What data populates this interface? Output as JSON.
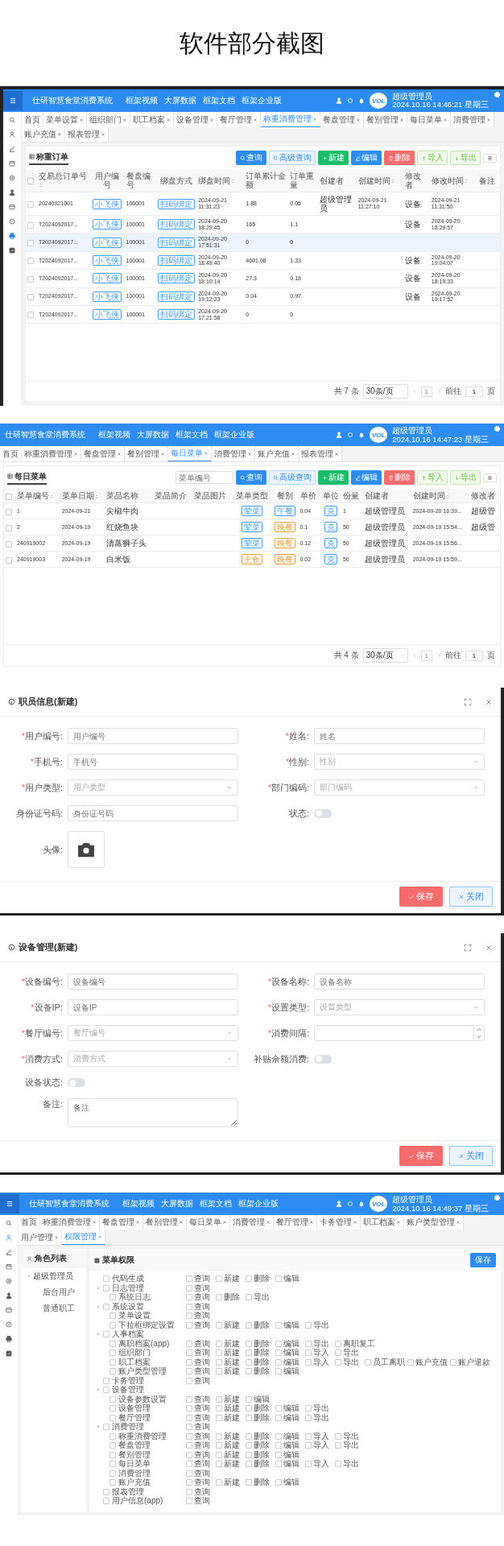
{
  "page_title": "软件部分截图",
  "order_screen": {
    "header": {
      "system_title": "仕研智慧食堂消费系统",
      "nav_links": [
        "框架视频",
        "大屏数据",
        "框架文档",
        "框架企业版"
      ],
      "logo_text": "VOL",
      "user_name": "超级管理员",
      "datetime": "2024.10.16 14:46:21 星期三"
    },
    "sidebar": [
      {
        "kind": "search",
        "selected": false
      },
      {
        "kind": "user",
        "selected": false
      },
      {
        "kind": "pen",
        "selected": false
      },
      {
        "kind": "calendar",
        "selected": false
      },
      {
        "kind": "gear",
        "selected": false
      },
      {
        "kind": "person",
        "selected": false
      },
      {
        "kind": "card",
        "selected": false
      },
      {
        "kind": "link",
        "selected": false
      },
      {
        "kind": "printer",
        "selected": true
      },
      {
        "kind": "checklist",
        "selected": false
      }
    ],
    "tabs": [
      {
        "label": "首页",
        "selected": false,
        "closable": false
      },
      {
        "label": "菜单设置",
        "selected": false,
        "closable": true
      },
      {
        "label": "组织部门",
        "selected": false,
        "closable": true
      },
      {
        "label": "职工档案",
        "selected": false,
        "closable": true
      },
      {
        "label": "设备管理",
        "selected": false,
        "closable": true
      },
      {
        "label": "餐厅管理",
        "selected": false,
        "closable": true
      },
      {
        "label": "称重消费管理",
        "selected": true,
        "closable": true
      },
      {
        "label": "餐盘管理",
        "selected": false,
        "closable": true
      },
      {
        "label": "餐别管理",
        "selected": false,
        "closable": true
      },
      {
        "label": "每日菜单",
        "selected": false,
        "closable": true
      },
      {
        "label": "消费管理",
        "selected": false,
        "closable": true
      },
      {
        "label": "账户充值",
        "selected": false,
        "closable": true
      },
      {
        "label": "报表管理",
        "selected": false,
        "closable": true
      }
    ],
    "panel_title": "称重订单",
    "toolbar": [
      {
        "label": "查询",
        "kind": "query"
      },
      {
        "label": "高级查询",
        "kind": "advanced"
      },
      {
        "label": "新建",
        "kind": "create"
      },
      {
        "label": "编辑",
        "kind": "edit"
      },
      {
        "label": "删除",
        "kind": "delete"
      },
      {
        "label": "导入",
        "kind": "import"
      },
      {
        "label": "导出",
        "kind": "export"
      }
    ],
    "table": {
      "header_checked": false,
      "columns": [
        {
          "title": "交易总订单号",
          "kind": "code",
          "sortable": true
        },
        {
          "title": "用户编号",
          "kind": "tag",
          "sortable": false
        },
        {
          "title": "餐盘编号",
          "kind": "code",
          "sortable": false
        },
        {
          "title": "绑盘方式",
          "kind": "tag",
          "sortable": false
        },
        {
          "title": "绑盘时间",
          "kind": "code",
          "sortable": true
        },
        {
          "title": "订单累计金额",
          "kind": "code",
          "sortable": false
        },
        {
          "title": "订单重量",
          "kind": "code",
          "sortable": false
        },
        {
          "title": "创建者",
          "kind": "text",
          "sortable": false
        },
        {
          "title": "创建时间",
          "kind": "code",
          "sortable": true
        },
        {
          "title": "修改者",
          "kind": "text",
          "sortable": false
        },
        {
          "title": "修改时间",
          "kind": "code",
          "sortable": true
        },
        {
          "title": "备注",
          "kind": "text",
          "sortable": false
        }
      ],
      "rows": [
        {
          "selected": false,
          "checked": false,
          "cells": [
            "20240921001",
            {
              "text": "小飞侠",
              "color": "#409eff"
            },
            "100001",
            {
              "text": "扫码绑定",
              "color": "#409eff"
            },
            "2024-09-21 11:31:23",
            "1.88",
            "0.05",
            "超级管理员",
            "2024-09-21 11:27:10",
            "设备",
            "2024-09-21 11:31:50",
            null
          ]
        },
        {
          "selected": false,
          "checked": false,
          "cells": [
            "T2024092017...",
            {
              "text": "小飞侠",
              "color": "#409eff"
            },
            "100001",
            {
              "text": "扫码绑定",
              "color": "#409eff"
            },
            "2024-09-20 18:29:45",
            "165",
            "1.1",
            null,
            null,
            "设备",
            "2024-09-20 18:29:57",
            null
          ]
        },
        {
          "selected": true,
          "checked": false,
          "cells": [
            "T2024092017...",
            {
              "text": "小飞侠",
              "color": "#409eff"
            },
            "100001",
            {
              "text": "扫码绑定",
              "color": "#409eff"
            },
            "2024-09-20 17:51:31",
            "0",
            "0",
            null,
            null,
            null,
            null,
            null
          ]
        },
        {
          "selected": false,
          "checked": false,
          "cells": [
            "T2024092017...",
            {
              "text": "小飞侠",
              "color": "#409eff"
            },
            "100001",
            {
              "text": "扫码绑定",
              "color": "#409eff"
            },
            "2024-09-20 18:49:40",
            "4601.08",
            "1.33",
            null,
            null,
            "设备",
            "2024-09-20 19:04:07",
            null
          ]
        },
        {
          "selected": false,
          "checked": false,
          "cells": [
            "T2024092017...",
            {
              "text": "小飞侠",
              "color": "#409eff"
            },
            "100001",
            {
              "text": "扫码绑定",
              "color": "#409eff"
            },
            "2024-09-20 18:10:14",
            "27.3",
            "0.18",
            null,
            null,
            "设备",
            "2024-09-20 18:19:33",
            null
          ]
        },
        {
          "selected": false,
          "checked": false,
          "cells": [
            "T2024092017...",
            {
              "text": "小飞侠",
              "color": "#409eff"
            },
            "100001",
            {
              "text": "扫码绑定",
              "color": "#409eff"
            },
            "2024-09-20 19:12:23",
            "0.04",
            "0.97",
            null,
            null,
            "设备",
            "2024-09-20 19:17:52",
            null
          ]
        },
        {
          "selected": false,
          "checked": false,
          "cells": [
            "T2024092017...",
            {
              "text": "小飞侠",
              "color": "#409eff"
            },
            "100001",
            {
              "text": "扫码绑定",
              "color": "#409eff"
            },
            "2024-09-20 17:21:58",
            "0",
            "0",
            null,
            null,
            null,
            null,
            null
          ]
        }
      ]
    },
    "pagination": {
      "total": "共 7 条",
      "page_size": "30条/页",
      "pages": [
        {
          "label": "1",
          "selected": true
        }
      ],
      "goto_label": "前往",
      "goto_value": "1",
      "page_suffix": "页"
    }
  },
  "menu_screen": {
    "header": {
      "system_title": "仕研智慧食堂消费系统",
      "nav_links": [
        "框架视频",
        "大屏数据",
        "框架文档",
        "框架企业版"
      ],
      "logo_text": "VOL",
      "user_name": "超级管理员",
      "datetime": "2024.10.16 14:47:23 星期三"
    },
    "tabs": [
      {
        "label": "首页",
        "selected": false,
        "closable": false
      },
      {
        "label": "称重消费管理",
        "selected": false,
        "closable": true
      },
      {
        "label": "餐盘管理",
        "selected": false,
        "closable": true
      },
      {
        "label": "餐别管理",
        "selected": false,
        "closable": true
      },
      {
        "label": "每日菜单",
        "selected": true,
        "closable": true
      },
      {
        "label": "消费管理",
        "selected": false,
        "closable": true
      },
      {
        "label": "账户充值",
        "selected": false,
        "closable": true
      },
      {
        "label": "报表管理",
        "selected": false,
        "closable": true
      }
    ],
    "panel_title": "每日菜单",
    "search": {
      "placeholder": "菜单编号"
    },
    "toolbar": [
      {
        "label": "查询",
        "kind": "query"
      },
      {
        "label": "高级查询",
        "kind": "advanced"
      },
      {
        "label": "新建",
        "kind": "create"
      },
      {
        "label": "编辑",
        "kind": "edit"
      },
      {
        "label": "删除",
        "kind": "delete"
      },
      {
        "label": "导入",
        "kind": "import"
      },
      {
        "label": "导出",
        "kind": "export"
      }
    ],
    "table": {
      "header_checked": false,
      "columns": [
        {
          "title": "菜单编号",
          "kind": "code",
          "sortable": true
        },
        {
          "title": "菜单日期",
          "kind": "code",
          "sortable": true
        },
        {
          "title": "菜品名称",
          "kind": "text",
          "sortable": false
        },
        {
          "title": "菜品简介",
          "kind": "text",
          "sortable": false
        },
        {
          "title": "菜品图片",
          "kind": "text",
          "sortable": false
        },
        {
          "title": "菜单类型",
          "kind": "tag",
          "sortable": false
        },
        {
          "title": "餐别",
          "kind": "tag",
          "sortable": false
        },
        {
          "title": "单价",
          "kind": "code",
          "sortable": false
        },
        {
          "title": "单位",
          "kind": "tag",
          "sortable": false
        },
        {
          "title": "份量",
          "kind": "code",
          "sortable": false
        },
        {
          "title": "创建者",
          "kind": "text",
          "sortable": false
        },
        {
          "title": "创建时间",
          "kind": "code",
          "sortable": true
        },
        {
          "title": "修改者",
          "kind": "text",
          "sortable": false
        }
      ],
      "rows": [
        {
          "selected": false,
          "checked": false,
          "cells": [
            "1",
            "2024-09-21",
            "尖椒牛肉",
            null,
            null,
            {
              "text": "荤菜",
              "color": "#409eff"
            },
            {
              "text": "午餐",
              "color": "#409eff"
            },
            "0.04",
            {
              "text": "克",
              "color": "#409eff"
            },
            "1",
            "超级管理员",
            "2024-09-20 16:39...",
            "超级管"
          ]
        },
        {
          "selected": false,
          "checked": false,
          "cells": [
            "2",
            "2024-09-19",
            "红烧鱼块",
            null,
            null,
            {
              "text": "荤菜",
              "color": "#409eff"
            },
            {
              "text": "晚餐",
              "color": "#e6a23c"
            },
            "0.1",
            {
              "text": "克",
              "color": "#409eff"
            },
            "50",
            "超级管理员",
            "2024-09-19 15:54...",
            "超级管"
          ]
        },
        {
          "selected": false,
          "checked": false,
          "cells": [
            "240919002",
            "2024-09-19",
            "清蒸狮子头",
            null,
            null,
            {
              "text": "荤菜",
              "color": "#409eff"
            },
            {
              "text": "晚餐",
              "color": "#e6a23c"
            },
            "0.12",
            {
              "text": "克",
              "color": "#409eff"
            },
            "50",
            "超级管理员",
            "2024-09-19 15:56...",
            null
          ]
        },
        {
          "selected": false,
          "checked": false,
          "cells": [
            "240919003",
            "2024-09-19",
            "白米饭",
            null,
            null,
            {
              "text": "主食",
              "color": "#e6a23c"
            },
            {
              "text": "晚餐",
              "color": "#e6a23c"
            },
            "0.02",
            {
              "text": "克",
              "color": "#409eff"
            },
            "50",
            "超级管理员",
            "2024-09-19 15:59...",
            null
          ]
        }
      ]
    },
    "pagination": {
      "total": "共 4 条",
      "page_size": "30条/页",
      "pages": [
        {
          "label": "1",
          "selected": true
        }
      ],
      "goto_label": "前往",
      "goto_value": "1",
      "page_suffix": "页"
    }
  },
  "staff_dialog": {
    "title": "职员信息(新建)",
    "required_mark": "*",
    "fields": [
      {
        "label": "用户编号:",
        "required": true,
        "kind": "input",
        "placeholder": "用户编号"
      },
      {
        "label": "姓名:",
        "required": true,
        "kind": "input",
        "placeholder": "姓名"
      },
      {
        "label": "手机号:",
        "required": true,
        "kind": "input",
        "placeholder": "手机号"
      },
      {
        "label": "性别:",
        "required": true,
        "kind": "select",
        "placeholder": "性别"
      },
      {
        "label": "用户类型:",
        "required": true,
        "kind": "select",
        "placeholder": "用户类型"
      },
      {
        "label": "部门编码:",
        "required": true,
        "kind": "select",
        "placeholder": "部门编码"
      },
      {
        "label": "身份证号码:",
        "required": false,
        "kind": "input",
        "placeholder": "身份证号码"
      },
      {
        "label": "状态:",
        "required": false,
        "kind": "switch",
        "on": false
      },
      {
        "label": "头像:",
        "required": false,
        "kind": "upload"
      }
    ],
    "buttons": [
      {
        "label": "保存",
        "kind": "primary"
      },
      {
        "label": "关闭",
        "kind": "secondary"
      }
    ]
  },
  "device_dialog": {
    "title": "设备管理(新建)",
    "required_mark": "*",
    "fields": [
      {
        "label": "设备编号:",
        "required": true,
        "kind": "input",
        "placeholder": "设备编号"
      },
      {
        "label": "设备名称:",
        "required": true,
        "kind": "input",
        "placeholder": "设备名称"
      },
      {
        "label": "设备IP:",
        "required": true,
        "kind": "input",
        "placeholder": "设备IP"
      },
      {
        "label": "设置类型:",
        "required": true,
        "kind": "select",
        "placeholder": "设置类型"
      },
      {
        "label": "餐厅编号:",
        "required": true,
        "kind": "select",
        "placeholder": "餐厅编号"
      },
      {
        "label": "消费间隔:",
        "required": true,
        "kind": "number"
      },
      {
        "label": "消费方式:",
        "required": true,
        "kind": "select",
        "placeholder": "消费方式"
      },
      {
        "label": "补贴余额消费:",
        "required": false,
        "kind": "switch",
        "on": false
      },
      {
        "label": "设备状态:",
        "required": false,
        "kind": "switch",
        "on": false
      },
      {
        "label": "备注:",
        "required": false,
        "kind": "textarea",
        "placeholder": "备注"
      }
    ],
    "buttons": [
      {
        "label": "保存",
        "kind": "primary"
      },
      {
        "label": "关闭",
        "kind": "secondary"
      }
    ]
  },
  "permission_screen": {
    "header": {
      "system_title": "仕研智慧食堂消费系统",
      "nav_links": [
        "框架视频",
        "大屏数据",
        "框架文档",
        "框架企业版"
      ],
      "logo_text": "VOL",
      "user_name": "超级管理员",
      "datetime": "2024.10.16 14:49:37 星期三"
    },
    "sidebar": [
      {
        "kind": "search",
        "selected": false
      },
      {
        "kind": "user",
        "selected": true
      },
      {
        "kind": "pen",
        "selected": false
      },
      {
        "kind": "calendar",
        "selected": false
      },
      {
        "kind": "gear",
        "selected": false
      },
      {
        "kind": "person",
        "selected": false
      },
      {
        "kind": "card",
        "selected": false
      },
      {
        "kind": "link",
        "selected": false
      },
      {
        "kind": "printer",
        "selected": false
      },
      {
        "kind": "checklist",
        "selected": false
      }
    ],
    "tabs": [
      {
        "label": "首页",
        "selected": false,
        "closable": false
      },
      {
        "label": "称重消费管理",
        "selected": false,
        "closable": true
      },
      {
        "label": "餐盘管理",
        "selected": false,
        "closable": true
      },
      {
        "label": "餐别管理",
        "selected": false,
        "closable": true
      },
      {
        "label": "每日菜单",
        "selected": false,
        "closable": true
      },
      {
        "label": "消费管理",
        "selected": false,
        "closable": true
      },
      {
        "label": "餐厅管理",
        "selected": false,
        "closable": true
      },
      {
        "label": "卡务管理",
        "selected": false,
        "closable": true
      },
      {
        "label": "职工档案",
        "selected": false,
        "closable": true
      },
      {
        "label": "账户类型管理",
        "selected": false,
        "closable": true
      },
      {
        "label": "用户管理",
        "selected": false,
        "closable": true
      },
      {
        "label": "权限管理",
        "selected": true,
        "closable": true
      }
    ],
    "roles": {
      "title": "角色列表",
      "tree": [
        {
          "label": "超级管理员",
          "expanded": true,
          "children": [
            {
              "label": "后台用户"
            },
            {
              "label": "普通职工"
            }
          ]
        }
      ]
    },
    "permissions": {
      "title": "菜单权限",
      "save_label": "保存",
      "tree": [
        {
          "label": "代码生成",
          "checked": false,
          "actions": [
            {
              "label": "查询",
              "checked": false
            },
            {
              "label": "新建",
              "checked": false
            },
            {
              "label": "删除",
              "checked": false
            },
            {
              "label": "编辑",
              "checked": false
            }
          ]
        },
        {
          "label": "日志管理",
          "checked": false,
          "expanded": true,
          "actions": [
            {
              "label": "查询",
              "checked": false
            }
          ],
          "children": [
            {
              "label": "系统日志",
              "checked": false,
              "actions": [
                {
                  "label": "查询",
                  "checked": false
                },
                {
                  "label": "删除",
                  "checked": false
                },
                {
                  "label": "导出",
                  "checked": false
                }
              ]
            }
          ]
        },
        {
          "label": "系统设置",
          "checked": false,
          "expanded": true,
          "actions": [
            {
              "label": "查询",
              "checked": false
            }
          ],
          "children": [
            {
              "label": "菜单设置",
              "checked": false,
              "actions": [
                {
                  "label": "查询",
                  "checked": false
                }
              ]
            },
            {
              "label": "下拉框绑定设置",
              "checked": false,
              "actions": [
                {
                  "label": "查询",
                  "checked": false
                },
                {
                  "label": "新建",
                  "checked": false
                },
                {
                  "label": "删除",
                  "checked": false
                },
                {
                  "label": "编辑",
                  "checked": false
                },
                {
                  "label": "导出",
                  "checked": false
                }
              ]
            }
          ]
        },
        {
          "label": "人事档案",
          "checked": false,
          "expanded": true,
          "children": [
            {
              "label": "离职档案(app)",
              "checked": false,
              "actions": [
                {
                  "label": "查询",
                  "checked": false
                },
                {
                  "label": "新建",
                  "checked": false
                },
                {
                  "label": "删除",
                  "checked": false
                },
                {
                  "label": "编辑",
                  "checked": false
                },
                {
                  "label": "导出",
                  "checked": false
                },
                {
                  "label": "离职复工",
                  "checked": false
                }
              ]
            },
            {
              "label": "组织部门",
              "checked": false,
              "actions": [
                {
                  "label": "查询",
                  "checked": false
                },
                {
                  "label": "新建",
                  "checked": false
                },
                {
                  "label": "删除",
                  "checked": false
                },
                {
                  "label": "编辑",
                  "checked": false
                },
                {
                  "label": "导入",
                  "checked": false
                },
                {
                  "label": "导出",
                  "checked": false
                }
              ]
            },
            {
              "label": "职工档案",
              "checked": false,
              "actions": [
                {
                  "label": "查询",
                  "checked": false
                },
                {
                  "label": "新建",
                  "checked": false
                },
                {
                  "label": "删除",
                  "checked": false
                },
                {
                  "label": "编辑",
                  "checked": false
                },
                {
                  "label": "导入",
                  "checked": false
                },
                {
                  "label": "导出",
                  "checked": false
                },
                {
                  "label": "员工离职",
                  "checked": false
                },
                {
                  "label": "账户充值",
                  "checked": false
                },
                {
                  "label": "账户退款",
                  "checked": false
                }
              ]
            },
            {
              "label": "账户类型管理",
              "checked": false,
              "actions": [
                {
                  "label": "查询",
                  "checked": false
                },
                {
                  "label": "新建",
                  "checked": false
                },
                {
                  "label": "删除",
                  "checked": false
                },
                {
                  "label": "编辑",
                  "checked": false
                }
              ]
            }
          ]
        },
        {
          "label": "卡务管理",
          "checked": false,
          "actions": [
            {
              "label": "查询",
              "checked": false
            }
          ]
        },
        {
          "label": "设备管理",
          "checked": false,
          "expanded": true,
          "children": [
            {
              "label": "设备参数设置",
              "checked": false,
              "actions": [
                {
                  "label": "查询",
                  "checked": false
                },
                {
                  "label": "新建",
                  "checked": false
                },
                {
                  "label": "编辑",
                  "checked": false
                }
              ]
            },
            {
              "label": "设备管理",
              "checked": false,
              "actions": [
                {
                  "label": "查询",
                  "checked": false
                },
                {
                  "label": "新建",
                  "checked": false
                },
                {
                  "label": "删除",
                  "checked": false
                },
                {
                  "label": "编辑",
                  "checked": false
                },
                {
                  "label": "导出",
                  "checked": false
                }
              ]
            },
            {
              "label": "餐厅管理",
              "checked": false,
              "actions": [
                {
                  "label": "查询",
                  "checked": false
                },
                {
                  "label": "新建",
                  "checked": false
                },
                {
                  "label": "删除",
                  "checked": false
                },
                {
                  "label": "编辑",
                  "checked": false
                },
                {
                  "label": "导出",
                  "checked": false
                }
              ]
            }
          ]
        },
        {
          "label": "消费管理",
          "checked": false,
          "expanded": true,
          "actions": [
            {
              "label": "查询",
              "checked": false
            }
          ],
          "children": [
            {
              "label": "称重消费管理",
              "checked": false,
              "actions": [
                {
                  "label": "查询",
                  "checked": false
                },
                {
                  "label": "新建",
                  "checked": false
                },
                {
                  "label": "删除",
                  "checked": false
                },
                {
                  "label": "编辑",
                  "checked": false
                },
                {
                  "label": "导入",
                  "checked": false
                },
                {
                  "label": "导出",
                  "checked": false
                }
              ]
            },
            {
              "label": "餐盘管理",
              "checked": false,
              "actions": [
                {
                  "label": "查询",
                  "checked": false
                },
                {
                  "label": "新建",
                  "checked": false
                },
                {
                  "label": "删除",
                  "checked": false
                },
                {
                  "label": "编辑",
                  "checked": false
                },
                {
                  "label": "导入",
                  "checked": false
                },
                {
                  "label": "导出",
                  "checked": false
                }
              ]
            },
            {
              "label": "餐别管理",
              "checked": false,
              "actions": [
                {
                  "label": "查询",
                  "checked": false
                },
                {
                  "label": "新建",
                  "checked": false
                },
                {
                  "label": "删除",
                  "checked": false
                },
                {
                  "label": "编辑",
                  "checked": false
                }
              ]
            },
            {
              "label": "每日菜单",
              "checked": false,
              "actions": [
                {
                  "label": "查询",
                  "checked": false
                },
                {
                  "label": "新建",
                  "checked": false
                },
                {
                  "label": "删除",
                  "checked": false
                },
                {
                  "label": "编辑",
                  "checked": false
                },
                {
                  "label": "导入",
                  "checked": false
                },
                {
                  "label": "导出",
                  "checked": false
                }
              ]
            },
            {
              "label": "消费管理",
              "checked": false,
              "actions": [
                {
                  "label": "查询",
                  "checked": false
                }
              ]
            },
            {
              "label": "账户充值",
              "checked": false,
              "actions": [
                {
                  "label": "查询",
                  "checked": false
                },
                {
                  "label": "新建",
                  "checked": false
                },
                {
                  "label": "删除",
                  "checked": false
                },
                {
                  "label": "编辑",
                  "checked": false
                }
              ]
            }
          ]
        },
        {
          "label": "报表管理",
          "checked": false,
          "actions": [
            {
              "label": "查询",
              "checked": false
            }
          ]
        },
        {
          "label": "用户信息(app)",
          "checked": false,
          "actions": [
            {
              "label": "查询",
              "checked": false
            }
          ]
        }
      ]
    }
  }
}
